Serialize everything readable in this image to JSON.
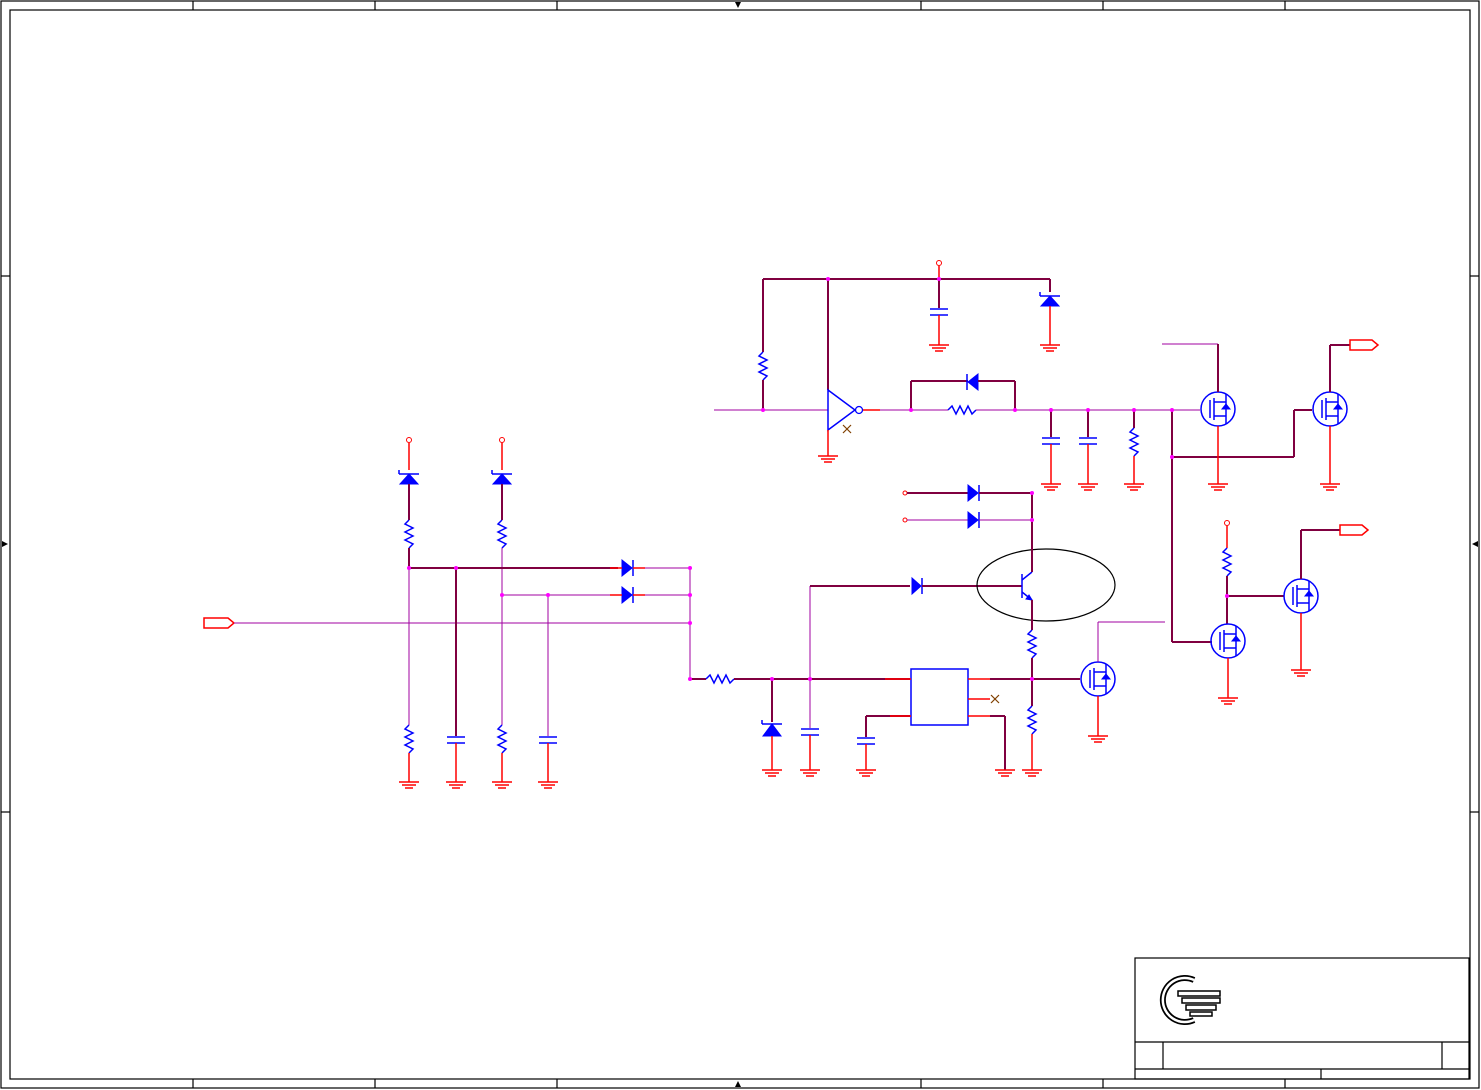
{
  "sheet": {
    "background": "#ffffff",
    "colors": {
      "wire": "#800040",
      "signal_wire": "#a000a0",
      "pin": "#ff0000",
      "component": "#0000ff",
      "junction": "#ff00ff",
      "frame": "#000000",
      "no_connect": "#804000"
    }
  },
  "components": {
    "transistor_highlight_ellipse": "selection-ellipse"
  },
  "title_block": {
    "logo_icon": "company-logo-icon"
  }
}
